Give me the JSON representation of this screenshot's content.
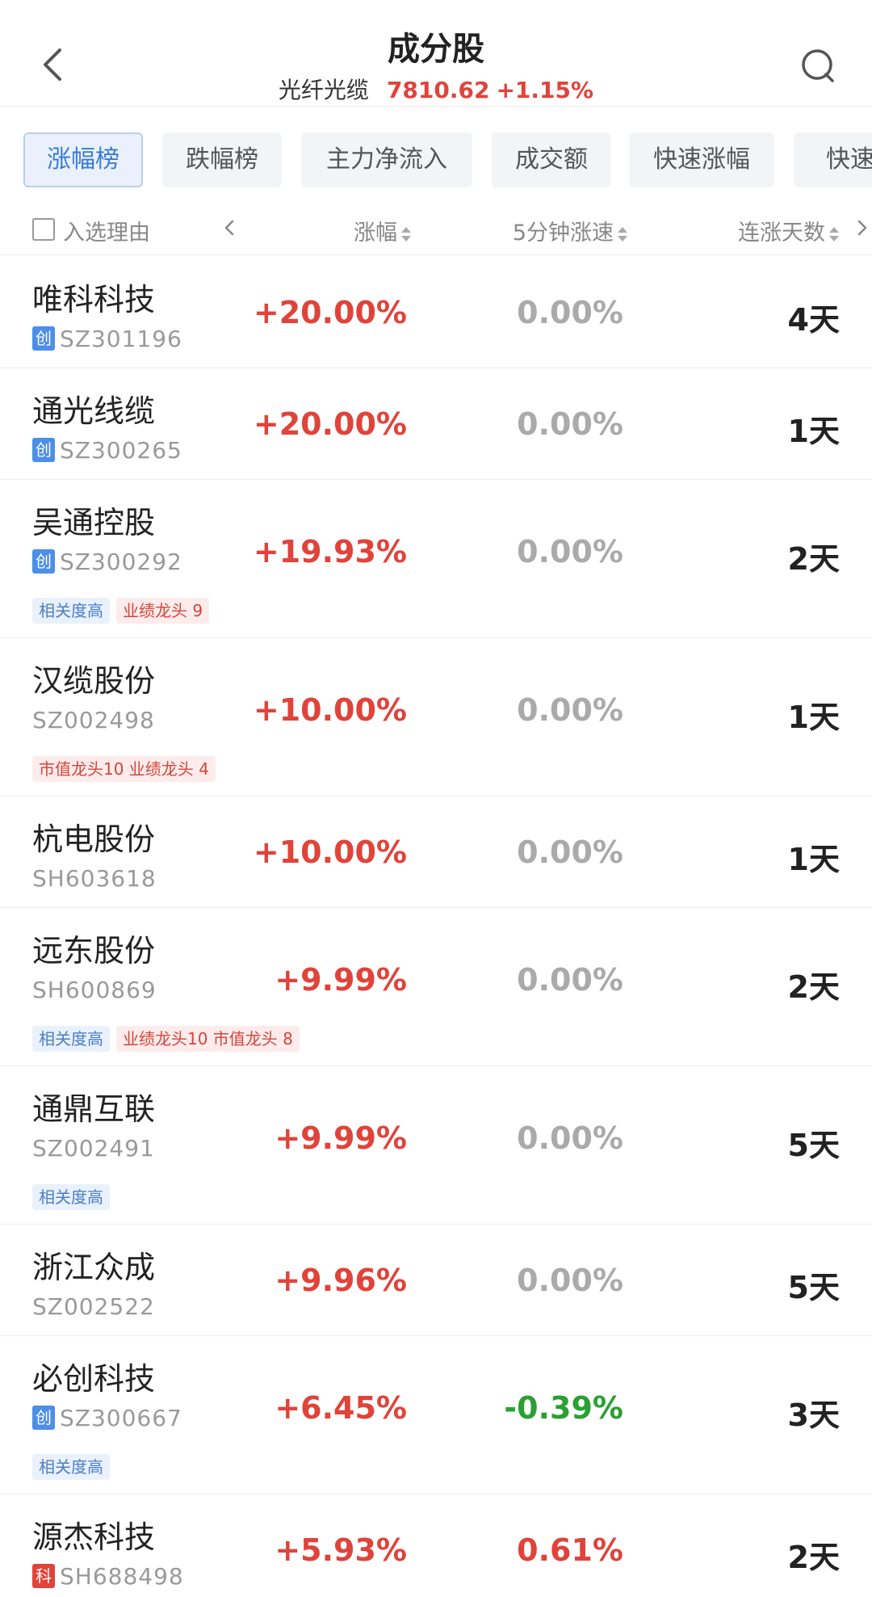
{
  "header": {
    "title": "成分股",
    "index_name": "光纤光缆",
    "index_value": "7810.62",
    "index_change": "+1.15%"
  },
  "tabs": [
    "涨幅榜",
    "跌幅榜",
    "主力净流入",
    "成交额",
    "快速涨幅",
    "快速"
  ],
  "columns": {
    "reason": "入选理由",
    "change": "涨幅",
    "speed": "5分钟涨速",
    "days": "连涨天数"
  },
  "rows": [
    {
      "name": "唯科科技",
      "board": "创",
      "code": "SZ301196",
      "change": "+20.00%",
      "speed": "0.00%",
      "days": "4天",
      "tags": []
    },
    {
      "name": "通光线缆",
      "board": "创",
      "code": "SZ300265",
      "change": "+20.00%",
      "speed": "0.00%",
      "days": "1天",
      "tags": []
    },
    {
      "name": "吴通控股",
      "board": "创",
      "code": "SZ300292",
      "change": "+19.93%",
      "speed": "0.00%",
      "days": "2天",
      "tags": [
        "相关度高",
        "业绩龙头 9"
      ]
    },
    {
      "name": "汉缆股份",
      "board": "",
      "code": "SZ002498",
      "change": "+10.00%",
      "speed": "0.00%",
      "days": "1天",
      "tags": [
        "市值龙头10 业绩龙头 4"
      ]
    },
    {
      "name": "杭电股份",
      "board": "",
      "code": "SH603618",
      "change": "+10.00%",
      "speed": "0.00%",
      "days": "1天",
      "tags": []
    },
    {
      "name": "远东股份",
      "board": "",
      "code": "SH600869",
      "change": "+9.99%",
      "speed": "0.00%",
      "days": "2天",
      "tags": [
        "相关度高",
        "业绩龙头10 市值龙头 8"
      ]
    },
    {
      "name": "通鼎互联",
      "board": "",
      "code": "SZ002491",
      "change": "+9.99%",
      "speed": "0.00%",
      "days": "5天",
      "tags": [
        "相关度高"
      ]
    },
    {
      "name": "浙江众成",
      "board": "",
      "code": "SZ002522",
      "change": "+9.96%",
      "speed": "0.00%",
      "days": "5天",
      "tags": []
    },
    {
      "name": "必创科技",
      "board": "创",
      "code": "SZ300667",
      "change": "+6.45%",
      "speed": "-0.39%",
      "days": "3天",
      "tags": [
        "相关度高"
      ]
    },
    {
      "name": "源杰科技",
      "board": "科",
      "code": "SH688498",
      "change": "+5.93%",
      "speed": "0.61%",
      "days": "2天",
      "tags": []
    }
  ],
  "colors": {
    "up": "#e0433a",
    "down": "#2aa033",
    "flat": "#aaaaaa",
    "accent": "#3a7bd5"
  },
  "icons": {
    "back": "chevron-left-icon",
    "search": "search-icon",
    "sort": "sort-updown-icon"
  }
}
